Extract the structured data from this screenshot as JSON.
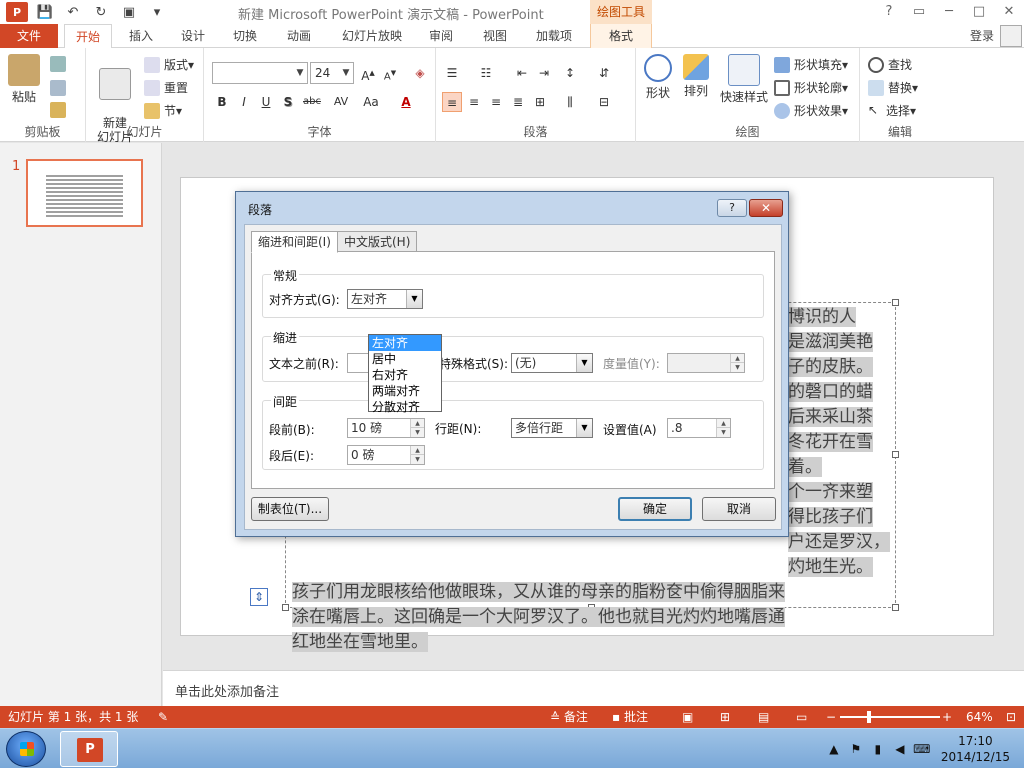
{
  "window": {
    "title": "新建 Microsoft PowerPoint 演示文稿 - PowerPoint",
    "app_logo": "P",
    "contextual_tab_group": "绘图工具",
    "controls": [
      "?",
      "▭",
      "─",
      "□",
      "✕"
    ]
  },
  "tabs": {
    "file": "文件",
    "items": [
      "开始",
      "插入",
      "设计",
      "切换",
      "动画",
      "幻灯片放映",
      "审阅",
      "视图",
      "加载项",
      "格式"
    ],
    "active": "开始",
    "login": "登录"
  },
  "ribbon": {
    "clipboard": {
      "label": "剪贴板",
      "paste": "粘贴"
    },
    "slides": {
      "label": "幻灯片",
      "new_slide": "新建\n幻灯片",
      "layout": "版式",
      "reset": "重置",
      "section": "节"
    },
    "font": {
      "label": "字体",
      "font_name": "",
      "font_size": "24",
      "bold": "B",
      "italic": "I",
      "underline": "U",
      "shadow": "S",
      "strike": "abc",
      "spacing": "AV",
      "case": "Aa",
      "color": "A"
    },
    "paragraph": {
      "label": "段落"
    },
    "drawing": {
      "label": "绘图",
      "shapes": "形状",
      "arrange": "排列",
      "quick_styles": "快速样式",
      "fill": "形状填充",
      "outline": "形状轮廓",
      "effects": "形状效果"
    },
    "editing": {
      "label": "编辑",
      "find": "查找",
      "replace": "替换",
      "select": "选择"
    }
  },
  "thumbnail": {
    "number": "1"
  },
  "slide_text": [
    "博识的人",
    "是滋润美艳",
    "子的皮肤。",
    "的磬口的蜡",
    "后来采山茶",
    "冬花开在雪",
    "着。",
    "个一齐来塑",
    "得比孩子们",
    "户还是罗汉，",
    "灼地生光。",
    "孩子们用龙眼核给他做眼珠，又从谁的母亲的脂粉奁中偷得胭脂来",
    "涂在嘴唇上。这回确是一个大阿罗汉了。他也就目光灼灼地嘴唇通",
    "红地坐在雪地里。"
  ],
  "notes": {
    "placeholder": "单击此处添加备注"
  },
  "status": {
    "slide_info": "幻灯片 第 1 张，共 1 张",
    "notes_btn": "备注",
    "comments_btn": "批注",
    "zoom": "64%",
    "zoom_fraction": 0.64
  },
  "taskbar": {
    "time": "17:10",
    "date": "2014/12/15",
    "app_letter": "P"
  },
  "dialog": {
    "title": "段落",
    "help": "?",
    "close": "✕",
    "tabs": [
      "缩进和间距(I)",
      "中文版式(H)"
    ],
    "general": {
      "title": "常规",
      "alignment_label": "对齐方式(G):",
      "alignment_value": "左对齐",
      "alignment_options": [
        "左对齐",
        "居中",
        "右对齐",
        "两端对齐",
        "分散对齐"
      ]
    },
    "indent": {
      "title": "缩进",
      "before_text_label": "文本之前(R):",
      "special_label": "特殊格式(S):",
      "special_value": "(无)",
      "measure_label": "度量值(Y):",
      "measure_value": ""
    },
    "spacing": {
      "title": "间距",
      "before_label": "段前(B):",
      "before_value": "10 磅",
      "after_label": "段后(E):",
      "after_value": "0 磅",
      "line_label": "行距(N):",
      "line_value": "多倍行距",
      "set_label": "设置值(A)",
      "set_value": ".8"
    },
    "tabs_button": "制表位(T)...",
    "ok": "确定",
    "cancel": "取消"
  }
}
